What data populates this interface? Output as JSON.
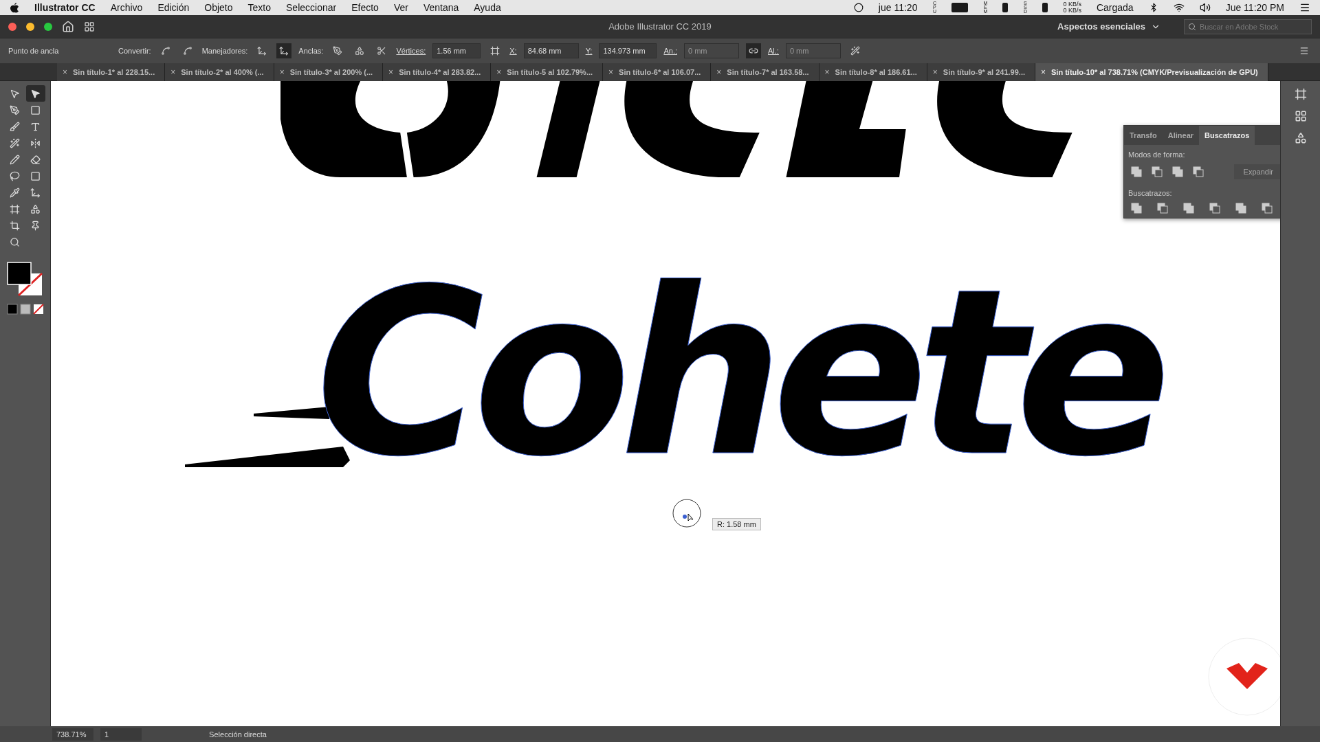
{
  "menu_bar": {
    "app": "Illustrator CC",
    "menus": [
      "Archivo",
      "Edición",
      "Objeto",
      "Texto",
      "Seleccionar",
      "Efecto",
      "Ver",
      "Ventana",
      "Ayuda"
    ],
    "clock_short": "jue 11:20",
    "meters": [
      "CPU",
      "MEM",
      "SSD"
    ],
    "net_up": "0 KB/s",
    "net_down": "0 KB/s",
    "battery_state": "Cargada",
    "clock": "Jue 11:20 PM"
  },
  "title_bar": {
    "title": "Adobe Illustrator CC 2019",
    "workspace": "Aspectos esenciales",
    "search": {
      "placeholder": "Buscar en Adobe Stock"
    }
  },
  "control_bar": {
    "selection": "Punto de ancla",
    "convert_label": "Convertir:",
    "handles_label": "Manejadores:",
    "handles": [
      {
        "selected": false
      },
      {
        "selected": true
      }
    ],
    "anchors_label": "Anclas:",
    "corners_label": "Vértices:",
    "corners_value": "1.56 mm",
    "x_label": "X:",
    "x_value": "84.68 mm",
    "y_label": "Y:",
    "y_value": "134.973 mm",
    "w_label": "An.:",
    "w_value": "0 mm",
    "w_disabled": true,
    "h_label": "Al.:",
    "h_value": "0 mm",
    "h_disabled": true
  },
  "tabs": [
    {
      "close": "×",
      "label": "Sin título-1* al 228.15...",
      "selected": false
    },
    {
      "close": "×",
      "label": "Sin título-2* al 400% (...",
      "selected": false
    },
    {
      "close": "×",
      "label": "Sin título-3* al 200% (...",
      "selected": false
    },
    {
      "close": "×",
      "label": "Sin título-4* al 283.82...",
      "selected": false
    },
    {
      "close": "×",
      "label": "Sin título-5 al 102.79%...",
      "selected": false
    },
    {
      "close": "×",
      "label": "Sin título-6* al 106.07...",
      "selected": false
    },
    {
      "close": "×",
      "label": "Sin título-7* al 163.58...",
      "selected": false
    },
    {
      "close": "×",
      "label": "Sin título-8* al 186.61...",
      "selected": false
    },
    {
      "close": "×",
      "label": "Sin título-9* al 241.99...",
      "selected": false
    },
    {
      "close": "×",
      "label": "Sin título-10* al 738.71% (CMYK/Previsualización de GPU)",
      "selected": true
    }
  ],
  "tools": [
    {
      "kind": "select",
      "selected": false
    },
    {
      "kind": "direct",
      "selected": true
    },
    {
      "kind": "pen",
      "selected": false
    },
    {
      "kind": "rect",
      "selected": false
    },
    {
      "kind": "brush",
      "selected": false
    },
    {
      "kind": "type",
      "selected": false
    },
    {
      "kind": "wand",
      "selected": false
    },
    {
      "kind": "reflect",
      "selected": false
    },
    {
      "kind": "pencil",
      "selected": false
    },
    {
      "kind": "eraser",
      "selected": false
    },
    {
      "kind": "lasso",
      "selected": false
    },
    {
      "kind": "gradient",
      "selected": false
    },
    {
      "kind": "eyedropper",
      "selected": false
    },
    {
      "kind": "puppet",
      "selected": false
    },
    {
      "kind": "artboard",
      "selected": false
    },
    {
      "kind": "shapes",
      "selected": false
    },
    {
      "kind": "crop",
      "selected": false
    },
    {
      "kind": "pin",
      "selected": false
    },
    {
      "kind": "zoom",
      "selected": false
    }
  ],
  "canvas": {
    "artwork": "Cohete",
    "tooltip": "R: 1.58 mm"
  },
  "panel": {
    "tabs": [
      {
        "label": "Transfo",
        "selected": false
      },
      {
        "label": "Alinear",
        "selected": false
      },
      {
        "label": "Buscatrazos",
        "selected": true
      }
    ],
    "shape_modes_label": "Modos de forma:",
    "expand": {
      "label": "Expandir",
      "disabled": true
    },
    "pathfinders_label": "Buscatrazos:"
  },
  "status_bar": {
    "zoom": "738.71%",
    "artboard": "1",
    "tool": "Selección directa"
  }
}
